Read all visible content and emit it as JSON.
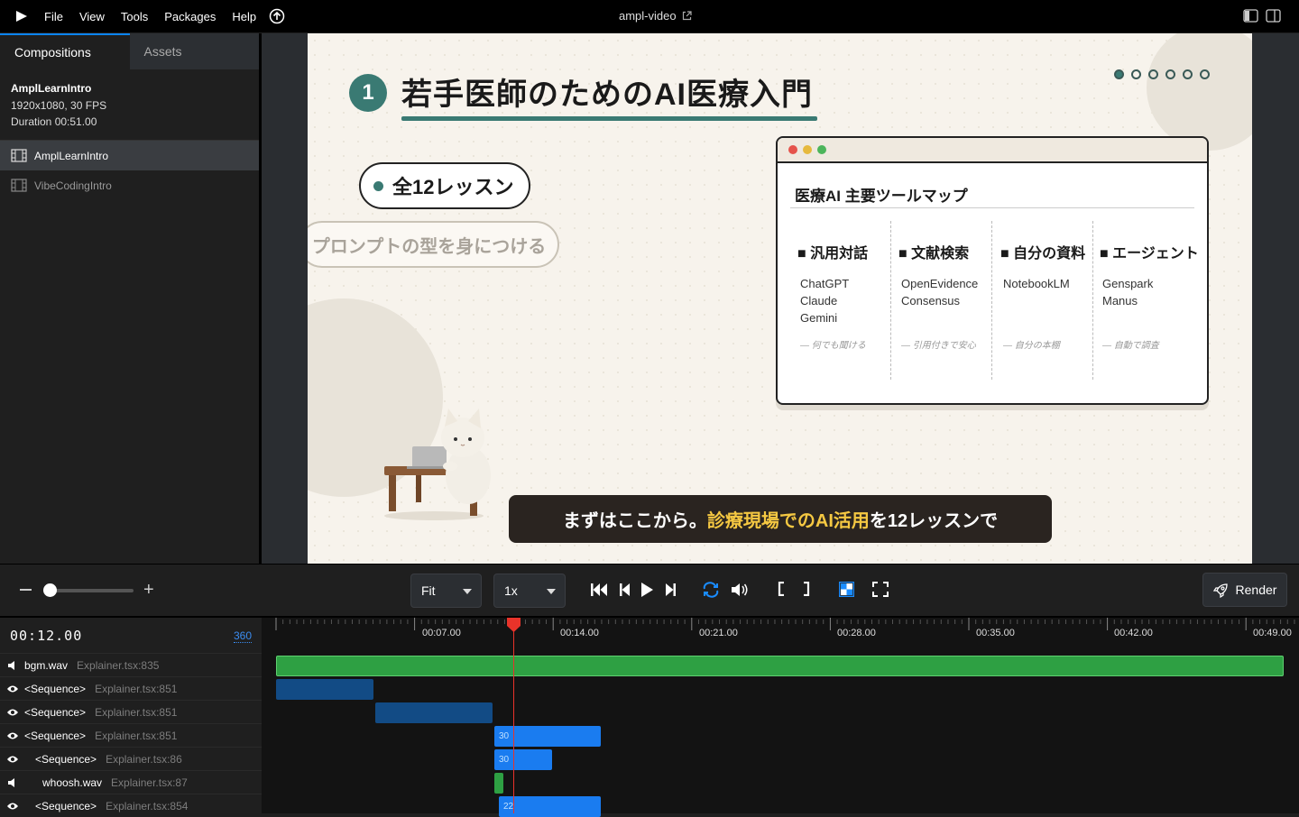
{
  "menubar": {
    "items": [
      "File",
      "View",
      "Tools",
      "Packages",
      "Help"
    ],
    "app_title": "ampl-video"
  },
  "left_panel": {
    "tabs": [
      "Compositions",
      "Assets"
    ],
    "composition": {
      "name": "AmplLearnIntro",
      "resolution": "1920x1080, 30 FPS",
      "duration": "Duration 00:51.00"
    },
    "list": [
      "AmplLearnIntro",
      "VibeCodingIntro"
    ]
  },
  "slide": {
    "number": "1",
    "title": "若手医師のためのAI医療入門",
    "pill_main": "全12レッスン",
    "pill_secondary": "プロンプトの型を身につける",
    "tool_map": {
      "title": "医療AI 主要ツールマップ",
      "columns": [
        {
          "head": "■ 汎用対話",
          "items": [
            "ChatGPT",
            "Claude",
            "Gemini"
          ],
          "note": "— 何でも聞ける"
        },
        {
          "head": "■ 文献検索",
          "items": [
            "OpenEvidence",
            "Consensus"
          ],
          "note": "— 引用付きで安心"
        },
        {
          "head": "■ 自分の資料",
          "items": [
            "NotebookLM"
          ],
          "note": "— 自分の本棚"
        },
        {
          "head": "■ エージェント",
          "items": [
            "Genspark",
            "Manus"
          ],
          "note": "— 自動で調査"
        }
      ]
    },
    "caption_pre": "まずはここから。",
    "caption_highlight": "診療現場でのAI活用",
    "caption_post": "を12レッスンで",
    "pagination_active": 1,
    "pagination_total": 6
  },
  "controls": {
    "fit_label": "Fit",
    "speed_label": "1x",
    "render_label": "Render"
  },
  "timeline": {
    "timecode": "00:12.00",
    "frame": "360",
    "ticks": [
      "00:07.00",
      "00:14.00",
      "00:21.00",
      "00:28.00",
      "00:35.00",
      "00:42.00",
      "00:49.00"
    ],
    "tracks": [
      {
        "icon": "speaker",
        "name": "bgm.wav",
        "file": "Explainer.tsx:835",
        "indent": 0
      },
      {
        "icon": "eye",
        "name": "<Sequence>",
        "file": "Explainer.tsx:851",
        "indent": 0
      },
      {
        "icon": "eye",
        "name": "<Sequence>",
        "file": "Explainer.tsx:851",
        "indent": 0
      },
      {
        "icon": "eye",
        "name": "<Sequence>",
        "file": "Explainer.tsx:851",
        "indent": 0
      },
      {
        "icon": "eye",
        "name": "<Sequence>",
        "file": "Explainer.tsx:86",
        "indent": 1
      },
      {
        "icon": "speaker",
        "name": "whoosh.wav",
        "file": "Explainer.tsx:87",
        "indent": 2
      },
      {
        "icon": "eye",
        "name": "<Sequence>",
        "file": "Explainer.tsx:854",
        "indent": 1
      }
    ],
    "clip_labels": [
      "30",
      "30",
      "22"
    ]
  },
  "colors": {
    "accent": "#0b84f3",
    "teal": "#3a7a73",
    "audio_clip": "#2ea043",
    "seq_clip_dark": "#124b85",
    "seq_clip_bright": "#1a7cf0",
    "playhead": "#e9332a",
    "highlight": "#f5c842"
  }
}
